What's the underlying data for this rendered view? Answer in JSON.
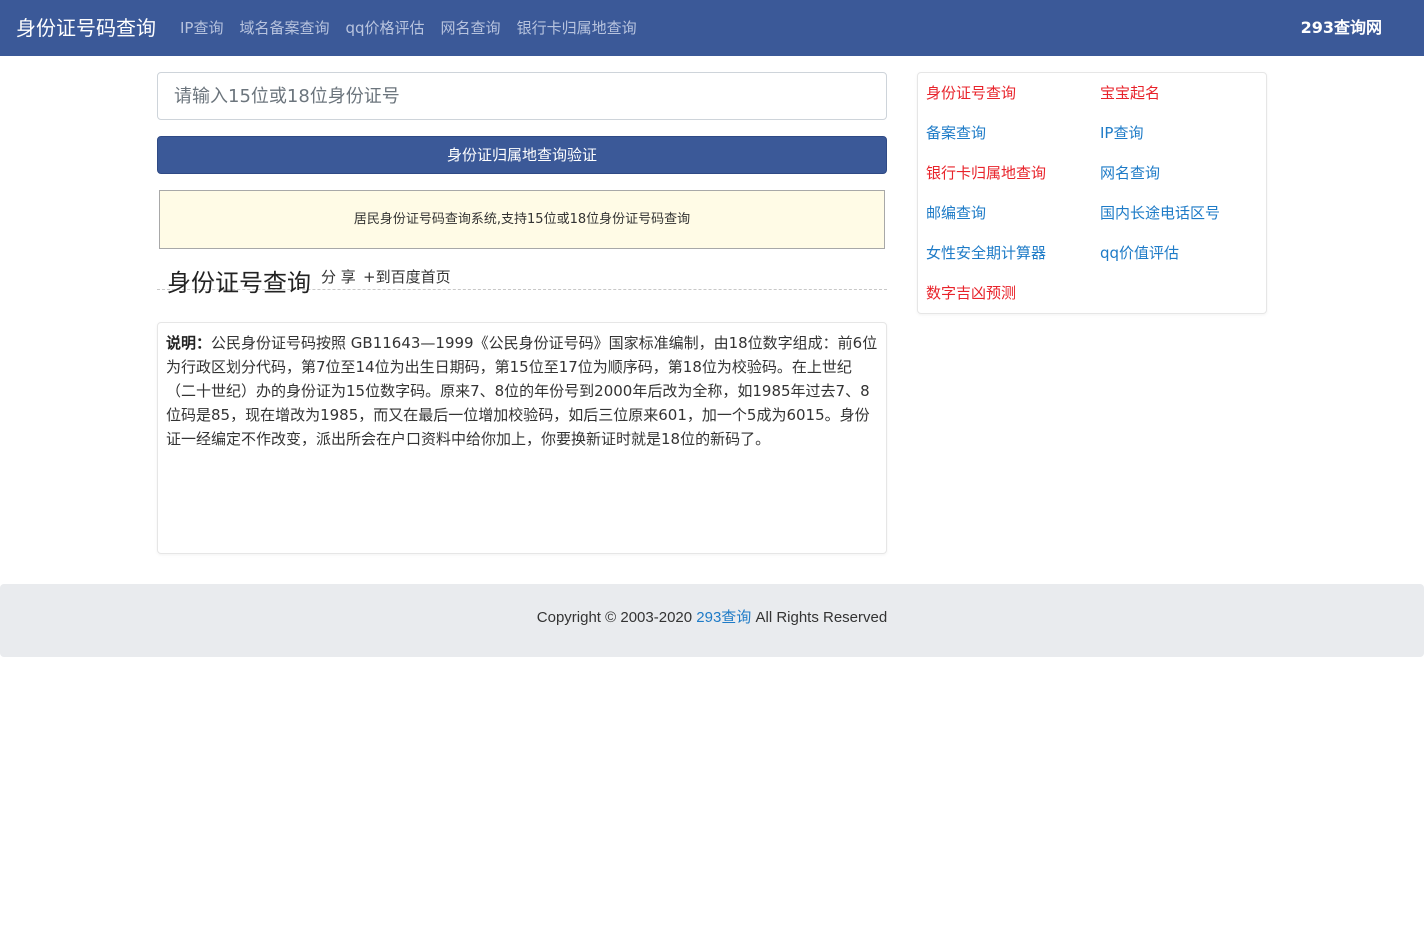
{
  "navbar": {
    "brand": "身份证号码查询",
    "links": [
      "IP查询",
      "域名备案查询",
      "qq价格评估",
      "网名查询",
      "银行卡归属地查询"
    ],
    "site_name": "293查询网"
  },
  "search": {
    "placeholder": "请输入15位或18位身份证号",
    "value": "",
    "button_label": "身份证归属地查询验证"
  },
  "notice": "居民身份证号码查询系统,支持15位或18位身份证号码查询",
  "section": {
    "title": "身份证号查询",
    "share": "分 享",
    "add_to_home": "+到百度首页"
  },
  "description": {
    "label": "说明：",
    "text": "公民身份证号码按照 GB11643—1999《公民身份证号码》国家标准编制，由18位数字组成：前6位为行政区划分代码，第7位至14位为出生日期码，第15位至17位为顺序码，第18位为校验码。在上世纪（二十世纪）办的身份证为15位数字码。原来7、8位的年份号到2000年后改为全称，如1985年过去7、8位码是85，现在增改为1985，而又在最后一位增加校验码，如后三位原来601，加一个5成为6015。身份证一经编定不作改变，派出所会在户口资料中给你加上，你要换新证时就是18位的新码了。"
  },
  "sidebar": {
    "items": [
      {
        "label": "身份证号查询",
        "color": "#e8232b"
      },
      {
        "label": "宝宝起名",
        "color": "#e8232b"
      },
      {
        "label": "备案查询",
        "color": "#1e7bc7"
      },
      {
        "label": "IP查询",
        "color": "#1e7bc7"
      },
      {
        "label": "银行卡归属地查询",
        "color": "#e8232b"
      },
      {
        "label": "网名查询",
        "color": "#1e7bc7"
      },
      {
        "label": "邮编查询",
        "color": "#1e7bc7"
      },
      {
        "label": "国内长途电话区号",
        "color": "#1e7bc7"
      },
      {
        "label": "女性安全期计算器",
        "color": "#1e7bc7"
      },
      {
        "label": "qq价值评估",
        "color": "#1e7bc7"
      },
      {
        "label": "数字吉凶预测",
        "color": "#e8232b"
      }
    ]
  },
  "footer": {
    "prefix": "Copyright © 2003-2020 ",
    "link": "293查询",
    "suffix": " All Rights Reserved"
  },
  "colors": {
    "navbar_bg": "#3b5998",
    "notice_bg": "#fffbe6",
    "link_blue": "#1e7bc7",
    "link_red": "#e8232b"
  }
}
